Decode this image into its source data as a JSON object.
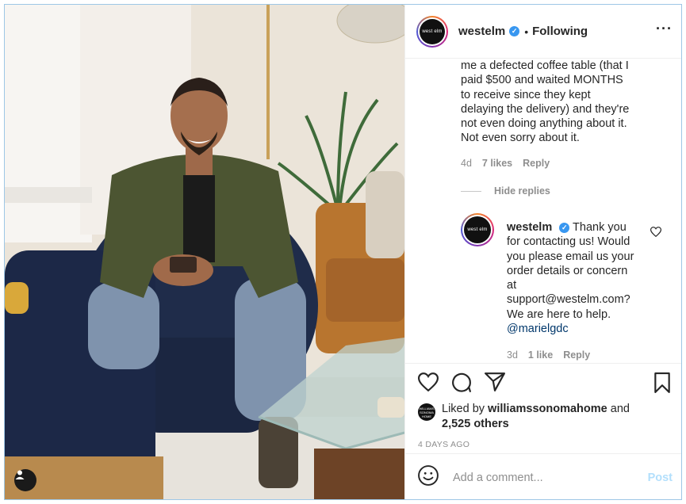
{
  "post": {
    "username": "westelm",
    "verified_mark": "✓",
    "separator": "•",
    "follow_status": "Following",
    "more_label": "···",
    "avatar_logo_text": "west elm"
  },
  "comment": {
    "text_lines": [
      "me a defected coffee table (that I",
      "paid $500 and waited MONTHS",
      "to receive since they kept",
      "delaying the delivery) and they're",
      "not even doing anything about it.",
      "Not even sorry about it."
    ],
    "age": "4d",
    "likes": "7 likes",
    "reply": "Reply"
  },
  "hide_replies": "Hide replies",
  "reply": {
    "username": "westelm",
    "text_lines": [
      "Thank you",
      "for contacting us! Would",
      "you please email us your",
      "order details or concern",
      "at",
      "support@westelm.com?",
      "We are here to help."
    ],
    "mention": "@marielgdc",
    "age": "3d",
    "likes": "1 like",
    "reply": "Reply"
  },
  "likes": {
    "prefix": "Liked by",
    "user": "williamssonomahome",
    "suffix": "and",
    "others": "2,525 others",
    "avatar_text": "WILLIAMS SONOMA HOME"
  },
  "timestamp": "4 DAYS AGO",
  "comment_box": {
    "placeholder": "Add a comment...",
    "post_label": "Post"
  },
  "icons": {
    "heart": "heart-icon",
    "comment": "comment-icon",
    "share": "share-icon",
    "save": "bookmark-icon",
    "emoji": "emoji-icon",
    "user_tag": "user-icon"
  },
  "colors": {
    "verified": "#3897f0",
    "mention": "#00376b",
    "post_disabled": "#b2dffc",
    "muted": "#8e8e8e"
  }
}
